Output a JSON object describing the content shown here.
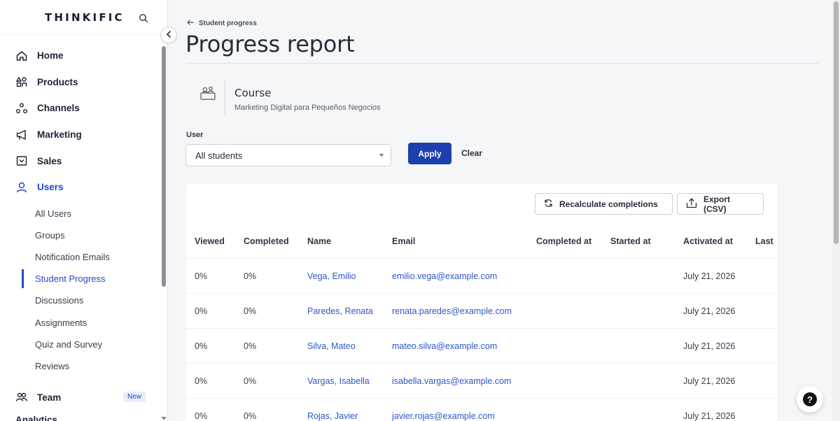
{
  "app": {
    "logo": "THINKIFIC"
  },
  "sidebar": {
    "items": [
      {
        "label": "Home",
        "icon": "home-icon"
      },
      {
        "label": "Products",
        "icon": "products-icon"
      },
      {
        "label": "Channels",
        "icon": "channels-icon"
      },
      {
        "label": "Marketing",
        "icon": "megaphone-icon"
      },
      {
        "label": "Sales",
        "icon": "sales-icon"
      },
      {
        "label": "Users",
        "icon": "user-icon",
        "active": true
      }
    ],
    "subitems": [
      {
        "label": "All Users"
      },
      {
        "label": "Groups"
      },
      {
        "label": "Notification Emails"
      },
      {
        "label": "Student Progress",
        "active": true
      },
      {
        "label": "Discussions"
      },
      {
        "label": "Assignments"
      },
      {
        "label": "Quiz and Survey"
      },
      {
        "label": "Reviews"
      }
    ],
    "team": {
      "label": "Team",
      "badge": "New",
      "icon": "team-icon"
    },
    "peek_label": "Analytics"
  },
  "header": {
    "breadcrumb": "Student progress",
    "title": "Progress report"
  },
  "course": {
    "heading": "Course",
    "name": "Marketing Digital para Pequeños Negocios"
  },
  "filter": {
    "user_label": "User",
    "user_value": "All students",
    "apply_label": "Apply",
    "clear_label": "Clear"
  },
  "toolbar": {
    "recalc_label": "Recalculate completions",
    "export_label": "Export (CSV)"
  },
  "table": {
    "headers": [
      "Viewed",
      "Completed",
      "Name",
      "Email",
      "Completed at",
      "Started at",
      "Activated at",
      "Last"
    ],
    "rows": [
      {
        "viewed": "0%",
        "completed": "0%",
        "name": "Vega, Emilio",
        "email": "emilio.vega@example.com",
        "completed_at": "",
        "started_at": "",
        "activated_at": "July 21, 2026"
      },
      {
        "viewed": "0%",
        "completed": "0%",
        "name": "Paredes, Renata",
        "email": "renata.paredes@example.com",
        "completed_at": "",
        "started_at": "",
        "activated_at": "July 21, 2026"
      },
      {
        "viewed": "0%",
        "completed": "0%",
        "name": "Silva, Mateo",
        "email": "mateo.silva@example.com",
        "completed_at": "",
        "started_at": "",
        "activated_at": "July 21, 2026"
      },
      {
        "viewed": "0%",
        "completed": "0%",
        "name": "Vargas, Isabella",
        "email": "isabella.vargas@example.com",
        "completed_at": "",
        "started_at": "",
        "activated_at": "July 21, 2026"
      },
      {
        "viewed": "0%",
        "completed": "0%",
        "name": "Rojas, Javier",
        "email": "javier.rojas@example.com",
        "completed_at": "",
        "started_at": "",
        "activated_at": "July 21, 2026"
      }
    ]
  },
  "help": {
    "label": "?"
  },
  "colors": {
    "accent": "#2249c5",
    "button_primary": "#1e3fae",
    "link": "#2d56c7"
  }
}
